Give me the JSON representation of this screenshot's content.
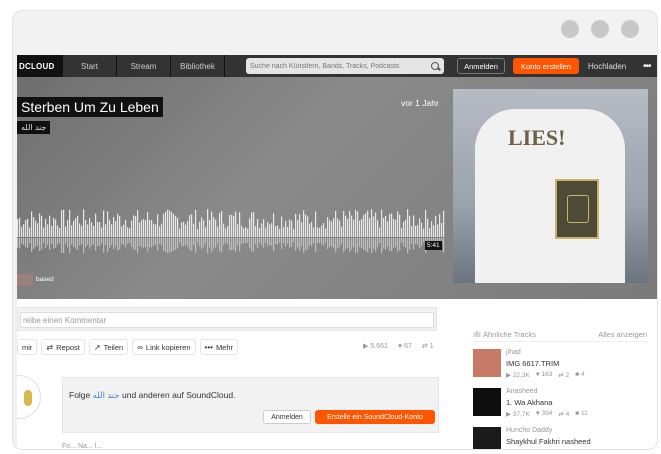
{
  "header": {
    "logo": "DCLOUD",
    "nav": [
      "Start",
      "Stream",
      "Bibliothek"
    ],
    "search_placeholder": "Suche nach Künstlern, Bands, Tracks, Podcasts",
    "login_label": "Anmelden",
    "signup_label": "Konto erstellen",
    "upload_label": "Hochladen",
    "more_label": "•••"
  },
  "track": {
    "title": "Sterben Um Zu Leben",
    "artist": "جند الله",
    "posted": "vor 1 Jahr",
    "duration": "5:41",
    "comment_user": "based",
    "artwork_text": "LIES!"
  },
  "comment": {
    "placeholder": "reibe einen Kommentar"
  },
  "actions": {
    "like_label": "mir",
    "repost_label": "Repost",
    "share_label": "Teilen",
    "copy_link_label": "Link kopieren",
    "more_label": "Mehr"
  },
  "stats": {
    "plays": "5.661",
    "likes": "67",
    "reposts": "1"
  },
  "follow": {
    "prefix": "Folge",
    "user": "جند الله",
    "suffix": "und anderen auf SoundCloud.",
    "login_label": "Anmelden",
    "signup_label": "Erstelle ein SoundCloud-Konto"
  },
  "cut_text": "Fo... Na... l...",
  "related": {
    "heading": "Ähnliche Tracks",
    "show_all": "Alles anzeigen",
    "tracks": [
      {
        "user": "jihad",
        "name": "IMG 6617.TRIM",
        "plays": "22,3K",
        "likes": "163",
        "reposts": "2",
        "comments": "4",
        "thumb_color": "#c97a67"
      },
      {
        "user": "Anasheed",
        "name": "1. Wa Akhana",
        "plays": "37,7K",
        "likes": "394",
        "reposts": "4",
        "comments": "11",
        "thumb_color": "#0e0e0e"
      },
      {
        "user": "Huncho Daddy",
        "name": "Shaykhul Fakhri nasheed",
        "plays": "",
        "likes": "",
        "reposts": "",
        "comments": "",
        "thumb_color": "#1a1a1a"
      }
    ]
  }
}
